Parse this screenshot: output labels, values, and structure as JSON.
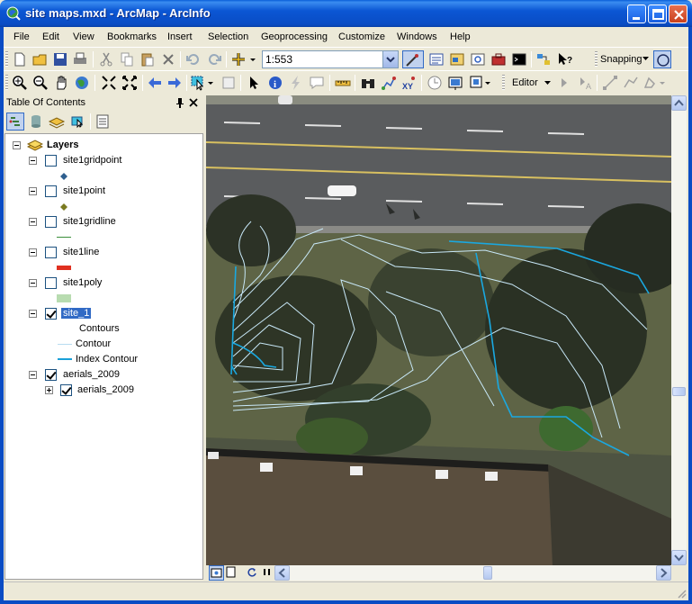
{
  "window": {
    "title": "site maps.mxd - ArcMap - ArcInfo",
    "minimize_icon": "minimize-icon",
    "maximize_icon": "maximize-icon",
    "close_icon": "close-icon"
  },
  "menu": {
    "items": [
      "File",
      "Edit",
      "View",
      "Bookmarks",
      "Insert",
      "Selection",
      "Geoprocessing",
      "Customize",
      "Windows",
      "Help"
    ]
  },
  "standard_toolbar": {
    "scale": "1:553",
    "snapping_label": "Snapping"
  },
  "tools_toolbar": {
    "editor_label": "Editor"
  },
  "toc": {
    "title": "Table Of Contents",
    "pin_icon": "pin-icon",
    "close_icon": "close-icon",
    "root": "Layers",
    "layers": [
      {
        "name": "site1gridpoint",
        "checked": false,
        "symbol": "diamond-point",
        "color": "#2f5f8f"
      },
      {
        "name": "site1point",
        "checked": false,
        "symbol": "diamond-point",
        "color": "#7a7a20"
      },
      {
        "name": "site1gridline",
        "checked": false,
        "symbol": "line",
        "color": "#3a8f3a"
      },
      {
        "name": "site1line",
        "checked": false,
        "symbol": "thick-line",
        "color": "#e03020"
      },
      {
        "name": "site1poly",
        "checked": false,
        "symbol": "fill",
        "color": "#b8dcb0"
      },
      {
        "name": "site_1",
        "checked": true,
        "selected": true
      },
      {
        "name": "aerials_2009",
        "checked": true
      }
    ],
    "site_1_legend": {
      "heading": "Contours",
      "items": [
        {
          "label": "Contour",
          "color": "#b8dcf0"
        },
        {
          "label": "Index Contour",
          "color": "#1aa0d8"
        }
      ]
    },
    "aerials_sublayer": "aerials_2009"
  },
  "map": {
    "contour_color": "#c8e8f8",
    "index_contour_color": "#1aa8e0"
  }
}
